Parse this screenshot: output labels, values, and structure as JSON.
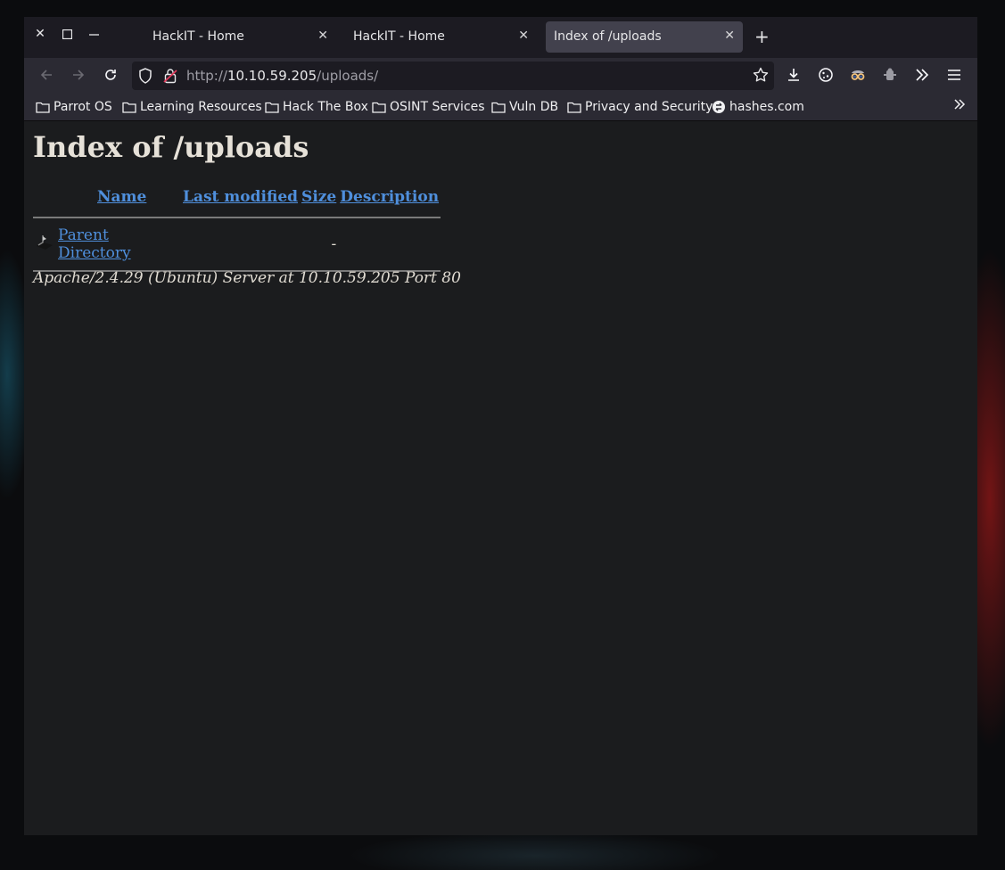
{
  "browser": {
    "tabs": [
      {
        "title": "HackIT - Home",
        "active": false
      },
      {
        "title": "HackIT - Home",
        "active": false
      },
      {
        "title": "Index of /uploads",
        "active": true
      }
    ],
    "url": {
      "prefix": "http://",
      "host": "10.10.59.205",
      "path": "/uploads/"
    },
    "bookmarks": [
      {
        "label": "Parrot OS",
        "icon": "folder-icon"
      },
      {
        "label": "Learning Resources",
        "icon": "folder-icon"
      },
      {
        "label": "Hack The Box",
        "icon": "folder-icon"
      },
      {
        "label": "OSINT Services",
        "icon": "folder-icon"
      },
      {
        "label": "Vuln DB",
        "icon": "folder-icon"
      },
      {
        "label": "Privacy and Security",
        "icon": "folder-icon"
      },
      {
        "label": "hashes.com",
        "icon": "hashes-logo-icon"
      }
    ]
  },
  "page": {
    "heading": "Index of /uploads",
    "columns": {
      "name": "Name",
      "last_modified": "Last modified",
      "size": "Size",
      "description": "Description"
    },
    "rows": [
      {
        "name": "Parent Directory",
        "last_modified": "",
        "size": "-",
        "description": ""
      }
    ],
    "footer": "Apache/2.4.29 (Ubuntu) Server at 10.10.59.205 Port 80"
  },
  "colors": {
    "link": "#4f8fdc",
    "page_bg": "#1b1c1e",
    "toolbar_bg": "#2b2a33",
    "active_tab": "#42414d"
  }
}
